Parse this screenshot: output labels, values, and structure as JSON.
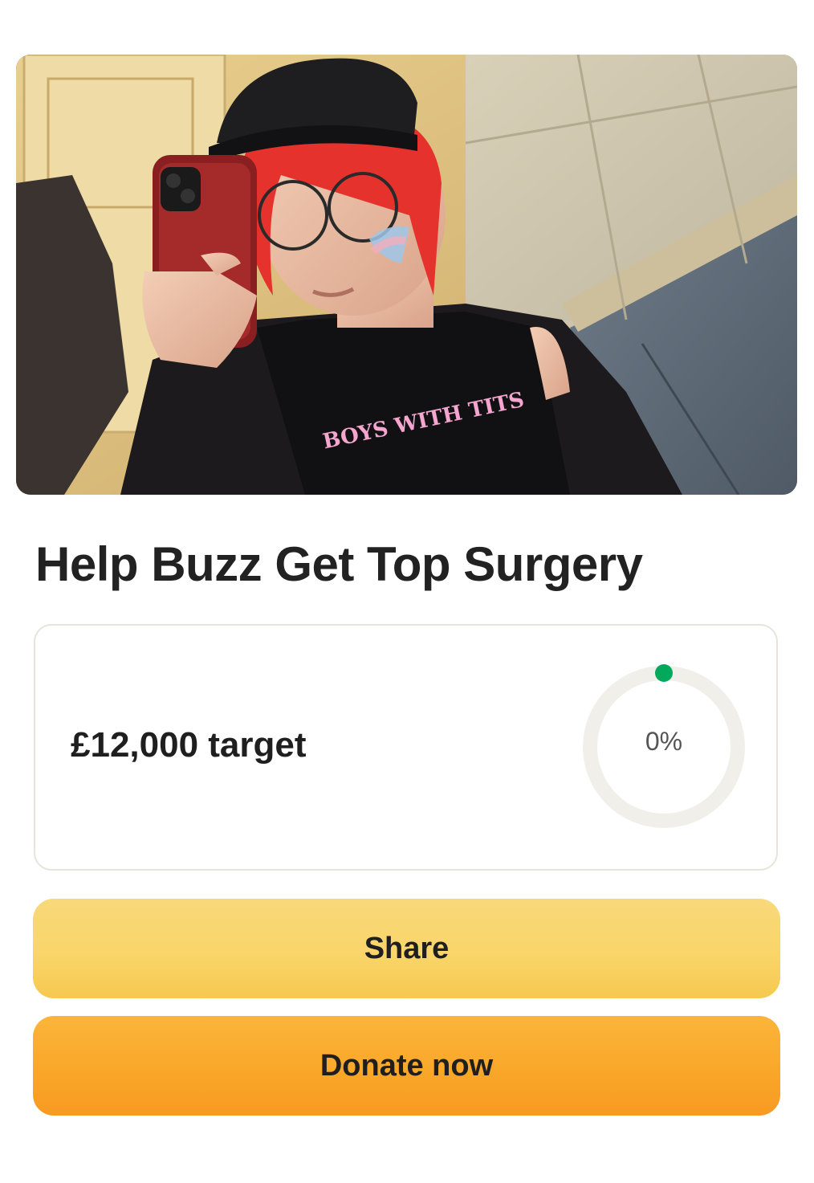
{
  "hero": {
    "photo_description_icon": "selfie-photo",
    "shirt_text": "BOYS WITH TITS"
  },
  "campaign": {
    "title": "Help Buzz Get Top Surgery",
    "target_label": "£12,000 target",
    "progress_label": "0%",
    "progress_fraction": 0.0
  },
  "actions": {
    "share_label": "Share",
    "donate_label": "Donate now"
  },
  "colors": {
    "share_button": "#f9d56a",
    "donate_button": "#f9a628",
    "progress_track": "#f1efea",
    "progress_indicator": "#02a95c"
  }
}
